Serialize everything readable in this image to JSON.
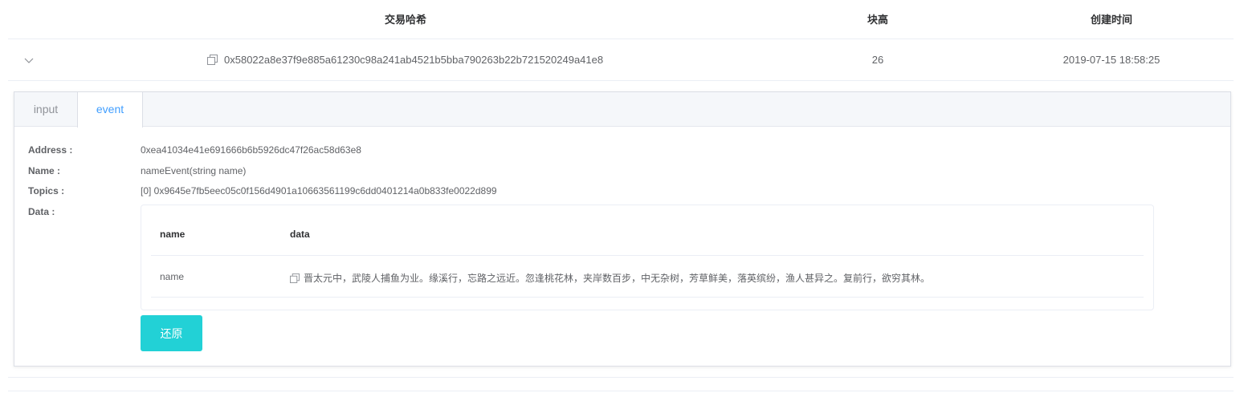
{
  "table": {
    "headers": {
      "hash": "交易哈希",
      "height": "块高",
      "time": "创建时间"
    },
    "row": {
      "hash": "0x58022a8e37f9e885a61230c98a241ab4521b5bba790263b22b721520249a41e8",
      "height": "26",
      "time": "2019-07-15 18:58:25"
    }
  },
  "tabs": {
    "input": "input",
    "event": "event",
    "active": "event"
  },
  "event": {
    "address_label": "Address :",
    "address": "0xea41034e41e691666b6b5926dc47f26ac58d63e8",
    "name_label": "Name :",
    "name": "nameEvent(string name)",
    "topics_label": "Topics :",
    "topics": "[0] 0x9645e7fb5eec05c0f156d4901a10663561199c6dd0401214a0b833fe0022d899",
    "data_label": "Data :",
    "data_table": {
      "headers": {
        "name": "name",
        "data": "data"
      },
      "rows": [
        {
          "name": "name",
          "data": "晋太元中，武陵人捕鱼为业。缘溪行，忘路之远近。忽逢桃花林，夹岸数百步，中无杂树，芳草鲜美，落英缤纷，渔人甚异之。复前行，欲穷其林。"
        }
      ]
    },
    "restore_label": "还原"
  },
  "icons": {
    "expand": "chevron-down-icon",
    "copy": "copy-icon"
  },
  "colors": {
    "accent": "#409eff",
    "button": "#22d1d6"
  }
}
